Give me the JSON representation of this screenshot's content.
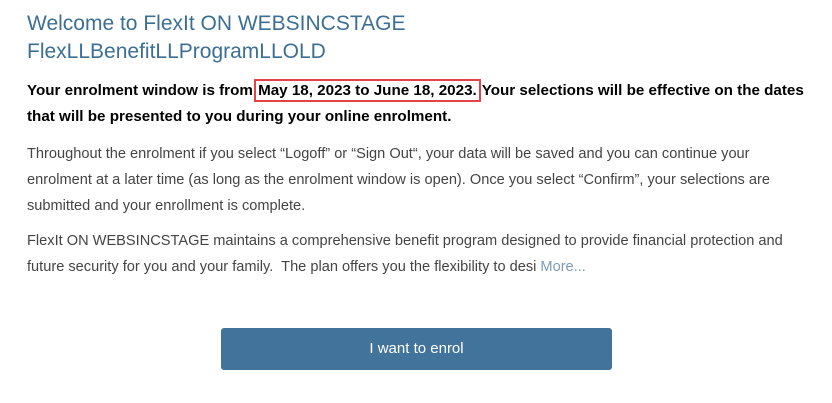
{
  "header": {
    "title_line1": "Welcome to FlexIt ON WEBSINCSTAGE",
    "title_line2": "FlexLLBenefitLLProgramLLOLD"
  },
  "enrolment_window": {
    "prefix": "Your enrolment window is from ",
    "dates": "May 18, 2023 to June 18, 2023.",
    "suffix": " Your selections will be effective on the dates that will be presented to you during your online enrolment."
  },
  "info": {
    "paragraph1": "Throughout the enrolment if you select “Logoff” or “Sign Out“, your data will be saved and you can continue your enrolment at a later time (as long as the enrolment window is open). Once you select “Confirm”, your selections are submitted and your enrollment is complete.",
    "paragraph2": "FlexIt ON WEBSINCSTAGE maintains a comprehensive benefit program designed to provide financial protection and future security for you and your family.  The plan offers you the flexibility to desi",
    "more_link": "More..."
  },
  "actions": {
    "enrol_button": "I want to enrol"
  },
  "colors": {
    "title": "#3d6f94",
    "button": "#42739a",
    "highlight_border": "#e0434a",
    "link": "#7f9bb5"
  }
}
